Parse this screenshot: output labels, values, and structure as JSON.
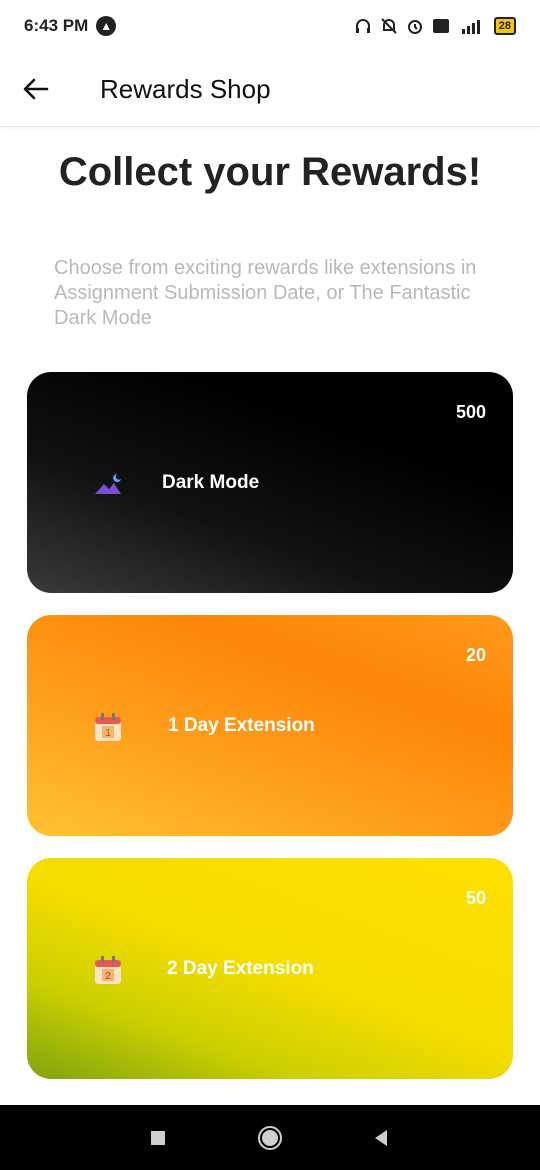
{
  "status_bar": {
    "time": "6:43 PM",
    "notification_icon": "a-icon",
    "battery": "28"
  },
  "app_bar": {
    "back_icon": "arrow-left-icon",
    "title": "Rewards Shop"
  },
  "main": {
    "headline": "Collect your Rewards!",
    "subtitle": "Choose from exciting rewards like extensions in Assignment Submission Date, or The Fantastic Dark Mode"
  },
  "rewards": [
    {
      "label": "Dark Mode",
      "price": "500",
      "icon": "dark-mode-icon"
    },
    {
      "label": "1 Day Extension",
      "price": "20",
      "icon": "calendar-1-icon"
    },
    {
      "label": "2 Day Extension",
      "price": "50",
      "icon": "calendar-2-icon"
    }
  ],
  "colors": {
    "card_dark": "#000000",
    "card_orange": "#fd8509",
    "card_yellow": "#ffe000"
  }
}
